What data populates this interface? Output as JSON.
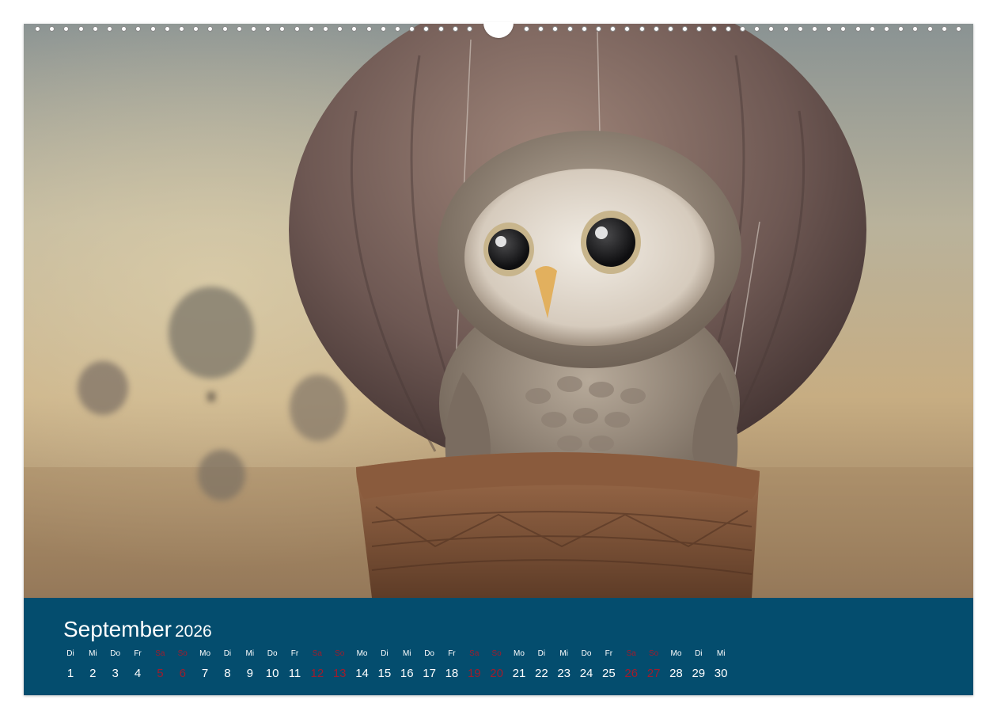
{
  "calendar": {
    "month": "September",
    "year": "2026",
    "weekend_color": "#a01c2c",
    "band_color": "#044d6e",
    "days": [
      {
        "dow": "Di",
        "num": "1",
        "weekend": false
      },
      {
        "dow": "Mi",
        "num": "2",
        "weekend": false
      },
      {
        "dow": "Do",
        "num": "3",
        "weekend": false
      },
      {
        "dow": "Fr",
        "num": "4",
        "weekend": false
      },
      {
        "dow": "Sa",
        "num": "5",
        "weekend": true
      },
      {
        "dow": "So",
        "num": "6",
        "weekend": true
      },
      {
        "dow": "Mo",
        "num": "7",
        "weekend": false
      },
      {
        "dow": "Di",
        "num": "8",
        "weekend": false
      },
      {
        "dow": "Mi",
        "num": "9",
        "weekend": false
      },
      {
        "dow": "Do",
        "num": "10",
        "weekend": false
      },
      {
        "dow": "Fr",
        "num": "11",
        "weekend": false
      },
      {
        "dow": "Sa",
        "num": "12",
        "weekend": true
      },
      {
        "dow": "So",
        "num": "13",
        "weekend": true
      },
      {
        "dow": "Mo",
        "num": "14",
        "weekend": false
      },
      {
        "dow": "Di",
        "num": "15",
        "weekend": false
      },
      {
        "dow": "Mi",
        "num": "16",
        "weekend": false
      },
      {
        "dow": "Do",
        "num": "17",
        "weekend": false
      },
      {
        "dow": "Fr",
        "num": "18",
        "weekend": false
      },
      {
        "dow": "Sa",
        "num": "19",
        "weekend": true
      },
      {
        "dow": "So",
        "num": "20",
        "weekend": true
      },
      {
        "dow": "Mo",
        "num": "21",
        "weekend": false
      },
      {
        "dow": "Di",
        "num": "22",
        "weekend": false
      },
      {
        "dow": "Mi",
        "num": "23",
        "weekend": false
      },
      {
        "dow": "Do",
        "num": "24",
        "weekend": false
      },
      {
        "dow": "Fr",
        "num": "25",
        "weekend": false
      },
      {
        "dow": "Sa",
        "num": "26",
        "weekend": true
      },
      {
        "dow": "So",
        "num": "27",
        "weekend": true
      },
      {
        "dow": "Mo",
        "num": "28",
        "weekend": false
      },
      {
        "dow": "Di",
        "num": "29",
        "weekend": false
      },
      {
        "dow": "Mi",
        "num": "30",
        "weekend": false
      }
    ]
  },
  "photo": {
    "subject": "owl-in-hot-air-balloon"
  }
}
